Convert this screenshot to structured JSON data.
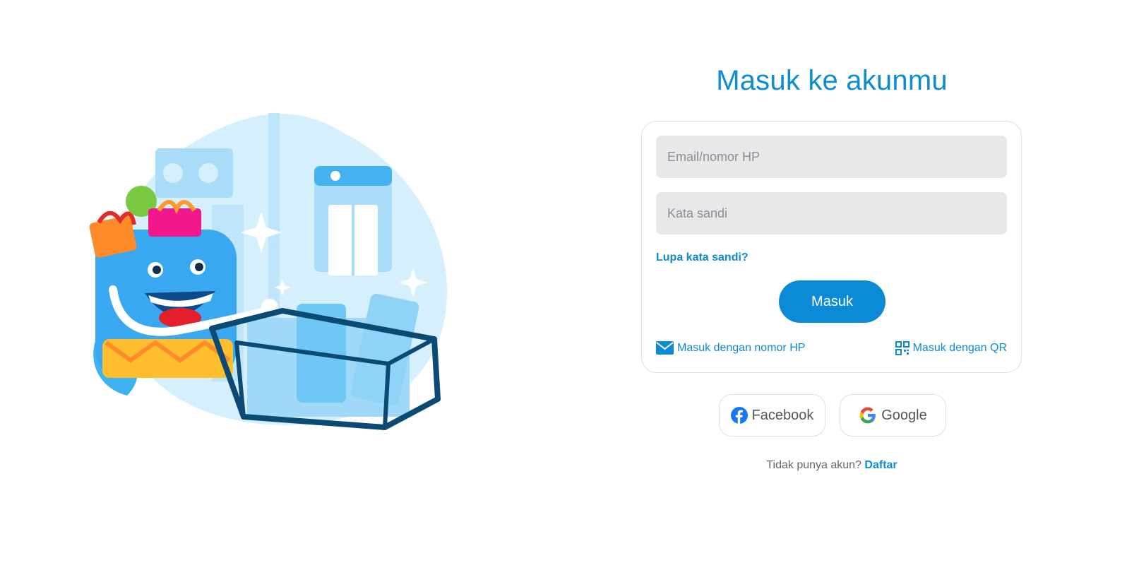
{
  "login": {
    "title": "Masuk ke akunmu",
    "email_placeholder": "Email/nomor HP",
    "password_placeholder": "Kata sandi",
    "forgot_label": "Lupa kata sandi?",
    "submit_label": "Masuk",
    "phone_login_label": "Masuk dengan nomor HP",
    "qr_login_label": "Masuk dengan QR"
  },
  "social": {
    "facebook_label": "Facebook",
    "google_label": "Google"
  },
  "signup": {
    "prompt": "Tidak punya akun?",
    "link_label": "Daftar"
  },
  "icons": {
    "phone_login": "envelope-icon",
    "qr_login": "qr-code-icon",
    "facebook": "facebook-icon",
    "google": "google-icon"
  },
  "colors": {
    "accent": "#0d8bd4",
    "button": "#0b8bd6",
    "field_bg": "#e7e8e9"
  }
}
